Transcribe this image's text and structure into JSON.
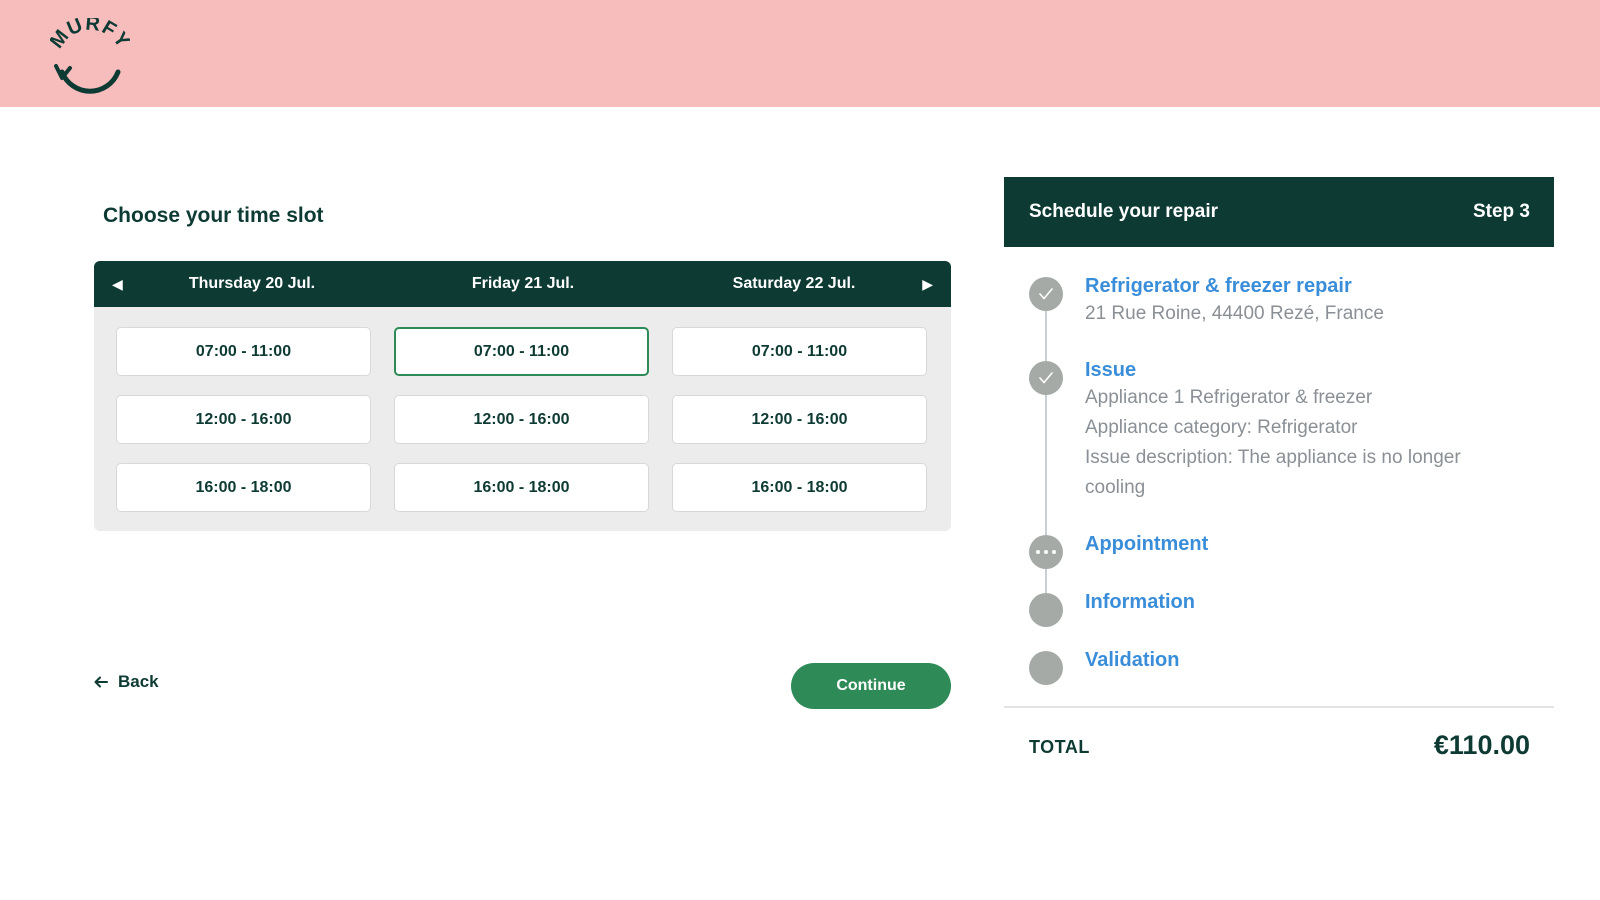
{
  "brand": {
    "logo_text": "MURFY",
    "header_color": "#f7bcbc",
    "dark_green": "#0e3a34",
    "accent_green": "#2e8b57",
    "link_blue": "#3a8ed9"
  },
  "slots": {
    "title": "Choose your time slot",
    "prev_icon": "triangle-left-icon",
    "next_icon": "triangle-right-icon",
    "days": [
      {
        "label": "Thursday 20 Jul.",
        "times": [
          "07:00 - 11:00",
          "12:00 - 16:00",
          "16:00 - 18:00"
        ]
      },
      {
        "label": "Friday 21 Jul.",
        "times": [
          "07:00 - 11:00",
          "12:00 - 16:00",
          "16:00 - 18:00"
        ]
      },
      {
        "label": "Saturday 22 Jul.",
        "times": [
          "07:00 - 11:00",
          "12:00 - 16:00",
          "16:00 - 18:00"
        ]
      }
    ],
    "selected": {
      "day": 1,
      "time": 0
    }
  },
  "nav": {
    "back_label": "Back",
    "back_icon": "arrow-left-icon",
    "continue_label": "Continue"
  },
  "summary": {
    "title": "Schedule your repair",
    "step_label": "Step 3",
    "steps": [
      {
        "title": "Refrigerator & freezer repair",
        "status": "done",
        "details": [
          "21 Rue Roine, 44400 Rezé, France"
        ]
      },
      {
        "title": "Issue",
        "status": "done",
        "details": [
          "Appliance 1 Refrigerator & freezer",
          "Appliance category: Refrigerator",
          "Issue description: The appliance is no longer",
          "cooling"
        ]
      },
      {
        "title": "Appointment",
        "status": "current",
        "details": []
      },
      {
        "title": "Information",
        "status": "todo",
        "details": []
      },
      {
        "title": "Validation",
        "status": "todo",
        "details": []
      }
    ],
    "total_label": "TOTAL",
    "total_value": "€110.00"
  }
}
